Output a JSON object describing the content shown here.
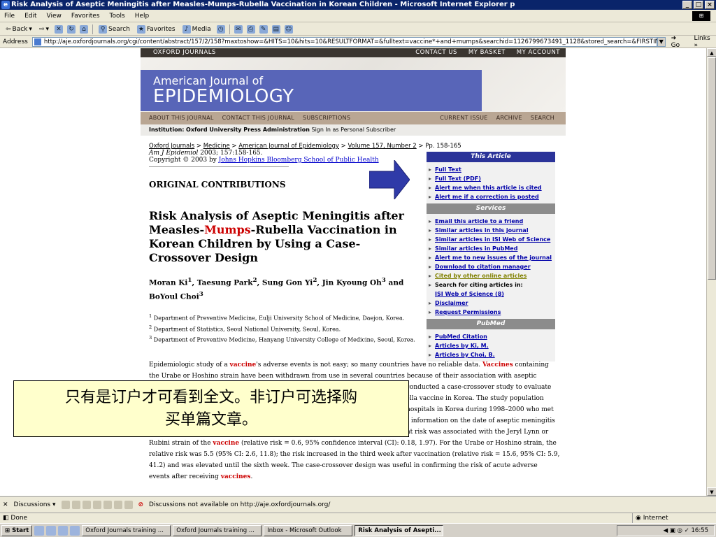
{
  "window": {
    "title": "Risk Analysis of Aseptic Meningitis after Measles-Mumps-Rubella Vaccination in Korean Children  - Microsoft Internet Explorer p",
    "buttons": [
      "_",
      "□",
      "×"
    ]
  },
  "menu": [
    "File",
    "Edit",
    "View",
    "Favorites",
    "Tools",
    "Help"
  ],
  "toolbar": {
    "back": "Back",
    "search": "Search",
    "favorites": "Favorites",
    "media": "Media"
  },
  "address": {
    "label": "Address",
    "url": "http://aje.oxfordjournals.org/cgi/content/abstract/157/2/158?maxtoshow=&HITS=10&hits=10&RESULTFORMAT=&fulltext=vaccine*+and+mumps&searchid=1126799673491_1128&stored_search=&FIRSTINDEX=0&journalcod",
    "go": "Go",
    "links": "Links"
  },
  "site": {
    "top_left": "OXFORD JOURNALS",
    "top_right": [
      "CONTACT US",
      "MY BASKET",
      "MY ACCOUNT"
    ],
    "journal_sub": "American Journal of",
    "journal_main": "EPIDEMIOLOGY",
    "nav_left": [
      "ABOUT THIS JOURNAL",
      "CONTACT THIS JOURNAL",
      "SUBSCRIPTIONS"
    ],
    "nav_right": [
      "CURRENT ISSUE",
      "ARCHIVE",
      "SEARCH"
    ],
    "institution_label": "Institution:",
    "institution_name": "Oxford University Press Administration",
    "sign_in": "Sign In as Personal Subscriber"
  },
  "breadcrumb": {
    "links": [
      "Oxford Journals",
      "Medicine",
      "American Journal of Epidemiology",
      "Volume 157, Number 2"
    ],
    "sep": ">",
    "pages": "Pp. 158-165"
  },
  "citation": {
    "journal": "Am J Epidemiol",
    "detail": "2003; 157:158-165.",
    "copyright": "Copyright © 2003 by",
    "publisher": "Johns Hopkins Bloomberg School of Public Health"
  },
  "section": "ORIGINAL CONTRIBUTIONS",
  "article": {
    "title_1": "Risk Analysis of Aseptic Meningitis after Measles-",
    "title_red": "Mumps",
    "title_2": "-Rubella Vaccination in Korean Children by Using a Case-Crossover Design",
    "authors_html": "Moran Ki<sup>1</sup>, Taesung Park<sup>2</sup>, Sung Gon Yi<sup>2</sup>, Jin Kyoung Oh<sup>3</sup> and BoYoul Choi<sup>3</sup>",
    "affiliations": [
      {
        "n": "1",
        "text": "Department of Preventive Medicine, Eulji University School of Medicine, Daejon, Korea."
      },
      {
        "n": "2",
        "text": "Department of Statistics, Seoul National University, Seoul, Korea."
      },
      {
        "n": "3",
        "text": "Department of Preventive Medicine, Hanyang University College of Medicine, Seoul, Korea."
      }
    ],
    "abstract_html": "Epidemiologic study of a <b class='red'>vaccine</b>'s adverse events is not easy; so many countries have no reliable data. <b class='red'>Vaccines</b> containing the Urabe or Hoshino strain have been withdrawn from use in several countries because of their association with aseptic meningitis, including a recommendation not to use specific strains. The authors conducted a case-crossover study to evaluate the risk of aseptic meningitis in children after receiving the measles-mumps-rubella vaccine in Korea. The study population consisted of children aged 8–36 months who had aseptic meningitis admitted to hospitals in Korea during 1998–2000 who met the previously defined criteria. Through a telephone survey, the authors obtained information on the date of aseptic meningitis and the participants' vaccination records. Study results showed that no significant risk was associated with the Jeryl Lynn or Rubini strain of the <b class='red'>vaccine</b> (relative risk = 0.6, 95% confidence interval (CI): 0.18, 1.97). For the Urabe or Hoshino strain, the relative risk was 5.5 (95% CI: 2.6, 11.8); the risk increased in the third week after vaccination (relative risk = 15.6, 95% CI: 5.9, 41.2) and was elevated until the sixth week. The case-crossover design was useful in confirming the risk of acute adverse events after receiving <b class='red'>vaccines</b>."
  },
  "sidebar": {
    "this_article": {
      "heading": "This Article",
      "items": [
        "Full Text",
        "Full Text (PDF)",
        "Alert me when this article is cited",
        "Alert me if a correction is posted"
      ]
    },
    "services": {
      "heading": "Services",
      "items": [
        "Email this article to a friend",
        "Similar articles in this journal",
        "Similar articles in ISI Web of Science",
        "Similar articles in PubMed",
        "Alert me to new issues of the journal",
        "Download to citation manager",
        "Cited by other online articles"
      ],
      "search_citing": "Search for citing articles in:",
      "isi_link": "ISI Web of Science (8)",
      "more": [
        "Disclaimer",
        "Request Permissions"
      ]
    },
    "pubmed": {
      "heading": "PubMed",
      "items": [
        "PubMed Citation",
        "Articles by Ki, M.",
        "Articles by Choi, B."
      ]
    }
  },
  "overlay_note": {
    "line1": "只有是订户才可看到全文。非订户可选择购",
    "line2": "买单篇文章。"
  },
  "discussions": {
    "label": "Discussions",
    "message": "Discussions not available on http://aje.oxfordjournals.org/"
  },
  "status": {
    "text": "Done",
    "zone": "Internet"
  },
  "taskbar": {
    "start": "Start",
    "tasks": [
      "Oxford Journals training ...",
      "Oxford Journals training ...",
      "Inbox - Microsoft Outlook",
      "Risk Analysis of Asepti..."
    ],
    "clock": "16:55"
  },
  "colors": {
    "title_bar": "#0a246a",
    "journal_blue": "#5865b8",
    "sidebar_blue": "#2b3399",
    "highlight_red": "#cc0000",
    "note_yellow": "#ffffcc"
  }
}
